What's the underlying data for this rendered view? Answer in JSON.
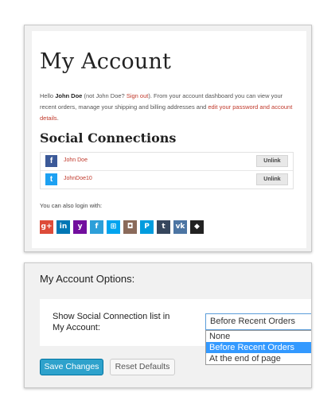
{
  "account": {
    "title": "My Account",
    "hello_prefix": "Hello ",
    "user_name": "John Doe",
    "not_prefix": " (not John Doe? ",
    "sign_out": "Sign out",
    "dashboard_text": "). From your account dashboard you can view your recent orders, manage your shipping and billing addresses and ",
    "edit_link": "edit your password and account details",
    "end": ".",
    "social_title": "Social Connections",
    "connections": [
      {
        "network": "facebook",
        "icon": "facebook-icon",
        "glyph": "f",
        "color": "#3b5998",
        "name": "John Doe",
        "action": "Unlink"
      },
      {
        "network": "twitter",
        "icon": "twitter-icon",
        "glyph": "t",
        "color": "#1da1f2",
        "name": "JohnDoe10",
        "action": "Unlink"
      }
    ],
    "also_login": "You can also login with:",
    "providers": [
      {
        "name": "google-plus",
        "glyph": "g+",
        "color": "#dd4b39"
      },
      {
        "name": "linkedin",
        "glyph": "in",
        "color": "#0077b5"
      },
      {
        "name": "yahoo",
        "glyph": "y",
        "color": "#720e9e"
      },
      {
        "name": "foursquare",
        "glyph": "f",
        "color": "#2d9fd9"
      },
      {
        "name": "windows",
        "glyph": "⊞",
        "color": "#00a4ef"
      },
      {
        "name": "instagram",
        "glyph": "◘",
        "color": "#8a6a5a"
      },
      {
        "name": "paypal",
        "glyph": "P",
        "color": "#009cde"
      },
      {
        "name": "tumblr",
        "glyph": "t",
        "color": "#36465d"
      },
      {
        "name": "vk",
        "glyph": "vk",
        "color": "#4c75a3"
      },
      {
        "name": "github",
        "glyph": "◆",
        "color": "#222222"
      }
    ]
  },
  "options": {
    "title": "My Account Options:",
    "label": "Show Social Connection list in My Account:",
    "selected": "Before Recent Orders",
    "choices": [
      "None",
      "Before Recent Orders",
      "At the end of page"
    ],
    "highlighted_index": 1,
    "save_label": "Save Changes",
    "reset_label": "Reset Defaults"
  }
}
